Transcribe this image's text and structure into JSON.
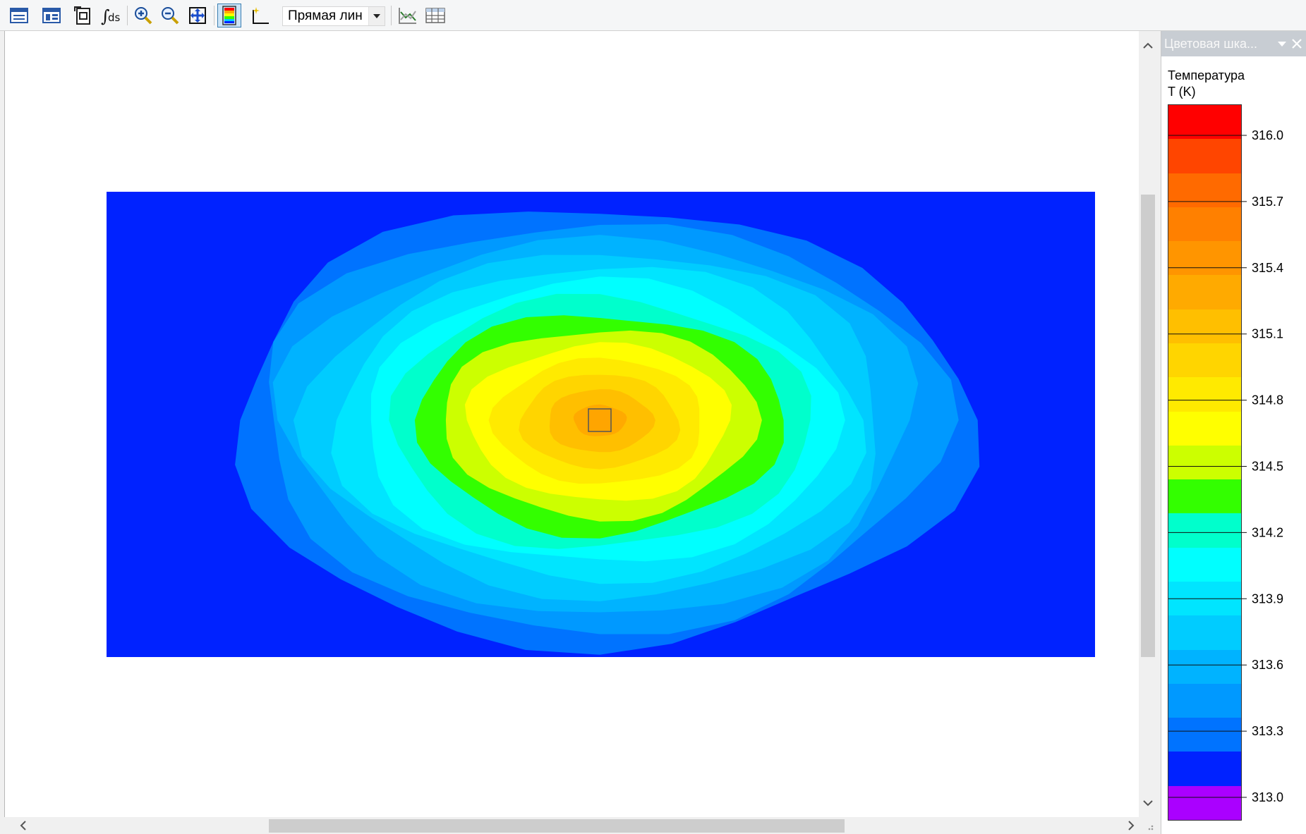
{
  "toolbar": {
    "buttons": [
      {
        "icon": "plot-properties-icon"
      },
      {
        "icon": "plot-table-icon"
      },
      {
        "icon": "export-image-icon"
      },
      {
        "icon": "integral-icon"
      },
      {
        "icon": "zoom-in-icon"
      },
      {
        "icon": "zoom-out-icon"
      },
      {
        "icon": "zoom-extents-icon"
      },
      {
        "icon": "color-scale-icon",
        "active": true
      },
      {
        "icon": "new-plot-icon"
      },
      {
        "icon": "line-graph-icon"
      },
      {
        "icon": "table-icon"
      }
    ],
    "line_type_select": "Прямая лин"
  },
  "color_panel": {
    "header": "Цветовая шка...",
    "quantity": "Температура",
    "unit": "T (K)",
    "ticks": [
      "316.0",
      "315.7",
      "315.4",
      "315.1",
      "314.8",
      "314.5",
      "314.2",
      "313.9",
      "313.6",
      "313.3",
      "313.0"
    ],
    "min": 313.0,
    "max": 316.0,
    "band_colors": [
      "#ff0000",
      "#ff4500",
      "#ff6a00",
      "#ff8000",
      "#ff9500",
      "#ffaa00",
      "#ffbf00",
      "#ffd500",
      "#ffea00",
      "#ffff00",
      "#ccff00",
      "#33ff00",
      "#00ffcc",
      "#00ffff",
      "#00e5ff",
      "#00ccff",
      "#00b3ff",
      "#0099ff",
      "#0073ff",
      "#0022ff",
      "#aa00ff"
    ]
  },
  "plot": {
    "background_color": "#0022ff",
    "source_marker_color": "#ffa500",
    "contour_levels": [
      {
        "value": 313.15,
        "color": "#0073ff"
      },
      {
        "value": 313.3,
        "color": "#0099ff"
      },
      {
        "value": 313.45,
        "color": "#00b3ff"
      },
      {
        "value": 313.6,
        "color": "#00ccff"
      },
      {
        "value": 313.75,
        "color": "#00e5ff"
      },
      {
        "value": 313.9,
        "color": "#00ffff"
      },
      {
        "value": 314.05,
        "color": "#00ffcc"
      },
      {
        "value": 314.2,
        "color": "#33ff00"
      },
      {
        "value": 314.35,
        "color": "#ccff00"
      },
      {
        "value": 314.5,
        "color": "#ffff00"
      },
      {
        "value": 314.65,
        "color": "#ffea00"
      },
      {
        "value": 314.8,
        "color": "#ffd500"
      },
      {
        "value": 314.95,
        "color": "#ffbf00"
      },
      {
        "value": 315.1,
        "color": "#ffaa00"
      }
    ]
  }
}
